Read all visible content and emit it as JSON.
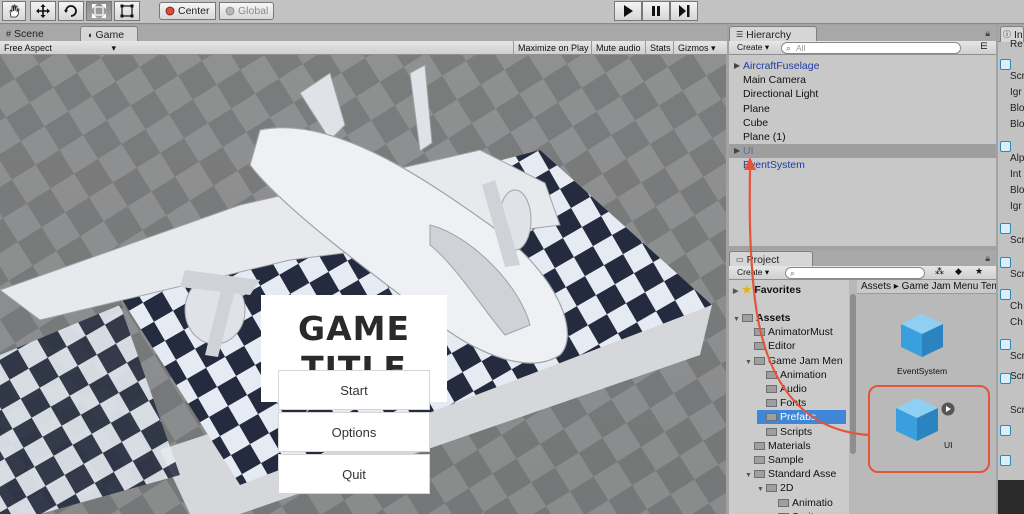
{
  "toolbar": {
    "tools": [
      "hand-icon",
      "move-icon",
      "rotate-icon",
      "scale-icon",
      "rect-tool-icon"
    ],
    "pivot_label": "Center",
    "space_label": "Global",
    "play_controls": [
      "play-icon",
      "pause-icon",
      "step-icon"
    ]
  },
  "scene_tab": {
    "label": "Scene"
  },
  "game_tab": {
    "label": "Game",
    "aspect": "Free Aspect",
    "options": [
      "Maximize on Play",
      "Mute audio",
      "Stats",
      "Gizmos"
    ]
  },
  "game": {
    "title_line1": "GAME",
    "title_line2": "TITLE",
    "buttons": [
      "Start",
      "Options",
      "Quit"
    ]
  },
  "hierarchy": {
    "tab_label": "Hierarchy",
    "create_label": "Create",
    "search_placeholder": "All",
    "items": [
      {
        "label": "AircraftFuselage",
        "style": "blue",
        "has_children": true
      },
      {
        "label": "Main Camera",
        "style": "normal"
      },
      {
        "label": "Directional Light",
        "style": "normal"
      },
      {
        "label": "Plane",
        "style": "normal"
      },
      {
        "label": "Cube",
        "style": "normal"
      },
      {
        "label": "Plane (1)",
        "style": "normal"
      },
      {
        "label": "UI",
        "style": "selected",
        "has_children": true
      },
      {
        "label": "EventSystem",
        "style": "blue"
      }
    ]
  },
  "project": {
    "tab_label": "Project",
    "create_label": "Create",
    "favorites_label": "Favorites",
    "tree": [
      {
        "label": "Assets",
        "depth": 0,
        "expanded": true,
        "bold": true
      },
      {
        "label": "AnimatorMust",
        "depth": 1
      },
      {
        "label": "Editor",
        "depth": 1
      },
      {
        "label": "Game Jam Men",
        "depth": 1,
        "expanded": true
      },
      {
        "label": "Animation",
        "depth": 2
      },
      {
        "label": "Audio",
        "depth": 2
      },
      {
        "label": "Fonts",
        "depth": 2
      },
      {
        "label": "Prefabs",
        "depth": 2,
        "selected": true
      },
      {
        "label": "Scripts",
        "depth": 2
      },
      {
        "label": "Materials",
        "depth": 1
      },
      {
        "label": "Sample",
        "depth": 1
      },
      {
        "label": "Standard Asse",
        "depth": 1,
        "expanded": true
      },
      {
        "label": "2D",
        "depth": 2,
        "expanded": true
      },
      {
        "label": "Animatio",
        "depth": 3
      },
      {
        "label": "Sprites",
        "depth": 3
      }
    ],
    "breadcrumb": [
      "Assets",
      "Game Jam Menu Tem"
    ],
    "assets": [
      {
        "label": "EventSystem"
      },
      {
        "label": "UI"
      }
    ]
  },
  "inspector": {
    "tab_label": "In",
    "rows": [
      "Re",
      "Scr",
      "Igr",
      "Blo",
      "Blo",
      "Alp",
      "Int",
      "Blo",
      "Igr",
      "Scr",
      "Scr",
      "Ch",
      "Ch",
      "Scr",
      "Scr",
      "Scr"
    ]
  },
  "colors": {
    "annotation": "#e5543a",
    "selection": "#3f86d8",
    "cube": "#3aa0dd"
  }
}
